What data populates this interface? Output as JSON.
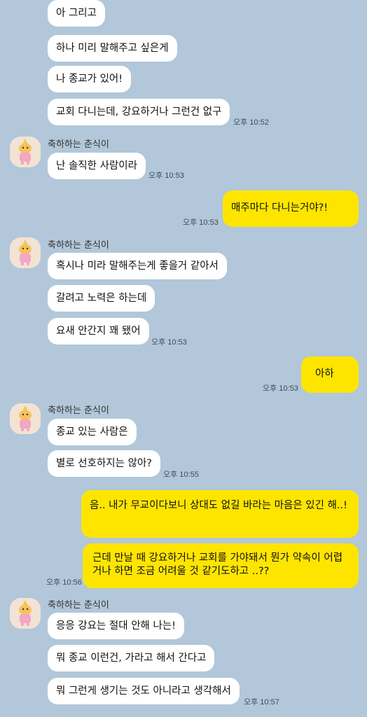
{
  "sender_name": "축하하는 춘식이",
  "messages": [
    {
      "text": "아 그리고"
    },
    {
      "text": "하나 미리 말해주고 싶은게"
    },
    {
      "text": "나 종교가 있어!"
    },
    {
      "text": "교회 다니는데, 강요하거나 그런건 없구",
      "time": "오후 10:52"
    },
    {
      "text": "난 솔직한 사람이라",
      "time": "오후 10:53"
    },
    {
      "text": "매주마다 다니는거야?!",
      "time": "오후 10:53"
    },
    {
      "text": "혹시나 미라 말해주는게 좋을거 같아서"
    },
    {
      "text": "갈려고 노력은 하는데"
    },
    {
      "text": "요새 안간지 꽤 됐어",
      "time": "오후 10:53"
    },
    {
      "text": "아하",
      "time": "오후 10:53"
    },
    {
      "text": "종교 있는 사람은"
    },
    {
      "text": "별로 선호하지는 않아?",
      "time": "오후 10:55"
    },
    {
      "text": "음.. 내가 무교이다보니 상대도 없길 바라는 마음은 있긴 해..!"
    },
    {
      "text": "근데 만날 때 강요하거나 교회를 가야돼서 뭔가 약속이 어렵거나 하면 조금 어려울 것 같기도하고 ..??",
      "time": "오후 10:56"
    },
    {
      "text": "응응 강요는 절대 안해 나는!"
    },
    {
      "text": "뭐 종교 이런건, 가라고 해서 간다고"
    },
    {
      "text": "뭐 그런게 생기는 것도 아니라고 생각해서",
      "time": "오후 10:57"
    }
  ],
  "colors": {
    "background": "#b2c7d9",
    "incoming_bubble": "#ffffff",
    "outgoing_bubble": "#fee500"
  },
  "icons": {
    "avatar": "choonsik-avatar-icon"
  }
}
